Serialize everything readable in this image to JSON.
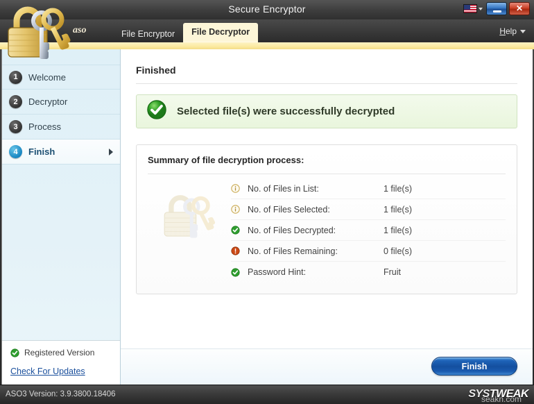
{
  "window": {
    "title": "Secure Encryptor",
    "minimize_label": "−",
    "close_label": "✕",
    "flag_icon": "us-flag-icon"
  },
  "nav": {
    "brand": "aso",
    "tabs": [
      {
        "label": "File Encryptor",
        "active": false
      },
      {
        "label": "File Decryptor",
        "active": true
      }
    ],
    "help": {
      "label_prefix": "H",
      "label_rest": "elp"
    }
  },
  "sidebar": {
    "steps": [
      {
        "num": "1",
        "label": "Welcome",
        "active": false
      },
      {
        "num": "2",
        "label": "Decryptor",
        "active": false
      },
      {
        "num": "3",
        "label": "Process",
        "active": false
      },
      {
        "num": "4",
        "label": "Finish",
        "active": true
      }
    ],
    "registered_label": "Registered Version",
    "check_updates_label": "Check For Updates"
  },
  "main": {
    "page_title": "Finished",
    "success_message": "Selected file(s) were successfully decrypted",
    "summary_title": "Summary of file decryption process:",
    "summary_rows": [
      {
        "icon": "info-icon",
        "label": "No. of Files in List:",
        "value": "1 file(s)"
      },
      {
        "icon": "info-icon",
        "label": "No. of Files Selected:",
        "value": "1 file(s)"
      },
      {
        "icon": "check-icon",
        "label": "No. of Files Decrypted:",
        "value": "1 file(s)"
      },
      {
        "icon": "warning-icon",
        "label": "No. of Files Remaining:",
        "value": "0 file(s)"
      },
      {
        "icon": "check-icon",
        "label": "Password Hint:",
        "value": "Fruit"
      }
    ]
  },
  "footer": {
    "finish_label": "Finish"
  },
  "statusbar": {
    "version_text": "ASO3 Version: 3.9.3800.18406",
    "logo_sys": "SYS",
    "logo_tweak": "TWEAK",
    "watermark": "seakn.com"
  },
  "colors": {
    "accent_blue": "#1684c0",
    "success_green": "#2f9e2f",
    "warning_red": "#cc4a16",
    "info_tan": "#cbab55",
    "tab_active_bg": "#fdf6d8",
    "sidebar_bg": "#dff0f7"
  }
}
